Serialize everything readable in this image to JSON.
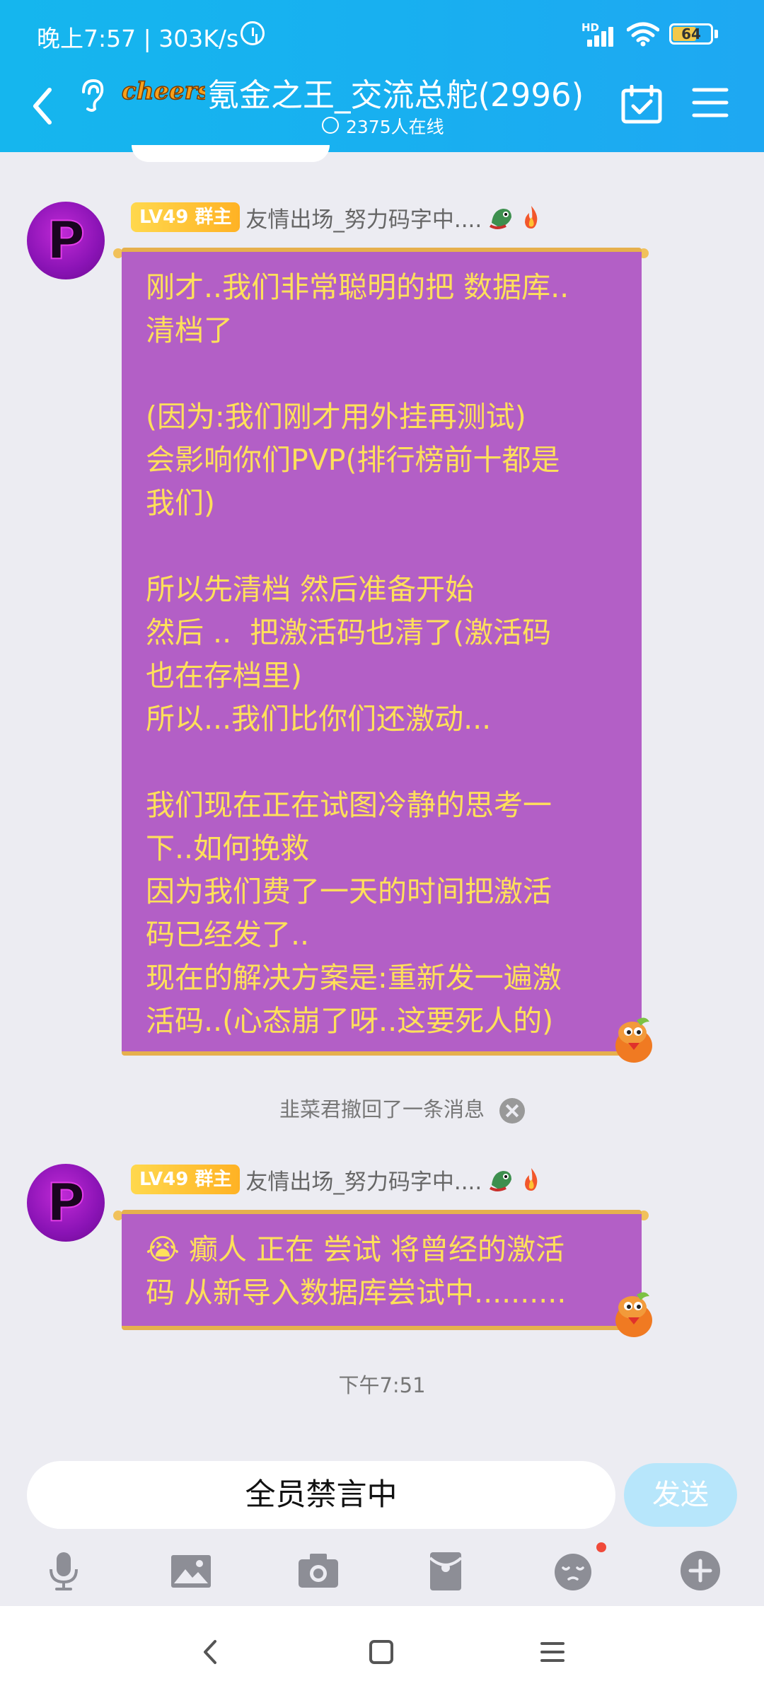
{
  "status_bar": {
    "time_speed": "晚上7:57 | 303K/s",
    "network": "HD",
    "battery": "64",
    "battery_level": 0.64
  },
  "header": {
    "sticker_text": "cheers",
    "title": "氪金之王_交流总舵(2996)",
    "online_count": "2375人在线"
  },
  "messages": [
    {
      "badge": "LV49 群主",
      "nickname": "友情出场_努力码字中....",
      "avatar_letter": "P",
      "text": "刚才..我们非常聪明的把 数据库..\n清档了\n\n(因为:我们刚才用外挂再测试)\n会影响你们PVP(排行榜前十都是\n我们)\n\n所以先清档 然后准备开始\n然后 ..  把激活码也清了(激活码\n也在存档里)\n所以...我们比你们还激动...\n\n我们现在正在试图冷静的思考一\n下..如何挽救\n因为我们费了一天的时间把激活\n码已经发了..\n现在的解决方案是:重新发一遍激\n活码..(心态崩了呀..这要死人的)"
    },
    {
      "badge": "LV49 群主",
      "nickname": "友情出场_努力码字中....",
      "avatar_letter": "P",
      "text": "😭 癫人 正在 尝试 将曾经的激活\n码 从新导入数据库尝试中.........."
    }
  ],
  "recall_notice": "韭菜君撤回了一条消息",
  "time_divider": "下午7:51",
  "input": {
    "mute_text": "全员禁言中",
    "send_label": "发送"
  },
  "toolbar_icons": [
    "microphone-icon",
    "image-icon",
    "camera-icon",
    "red-packet-icon",
    "emoji-icon",
    "plus-icon"
  ],
  "colors": {
    "header": "#18b0f0",
    "bubble": "#b35fc6",
    "bubble_text": "#ffe05a",
    "badge": "#ffc232"
  }
}
